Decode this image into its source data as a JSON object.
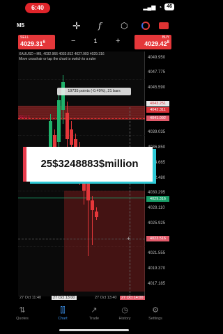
{
  "status": {
    "time": "6:40",
    "signal": "▂▄▆",
    "wifi": "◔",
    "battery": "46"
  },
  "toolbar": {
    "timeframe": "M5",
    "crosshair_icon": "crosshair-icon",
    "function_icon": "function-icon",
    "objects_icon": "objects-icon"
  },
  "trade": {
    "sell_label": "SELL",
    "sell_price_main": "4029.31",
    "sell_price_sup": "6",
    "buy_label": "BUY",
    "buy_price_main": "4029.42",
    "buy_price_sup": "8",
    "minus": "−",
    "volume": "1",
    "plus": "+"
  },
  "chart": {
    "symbol_info": "XAUUSD • M5, 4032.966 4033.812 4027.903 4029.316",
    "hint": "Move crosshair or tap the chart to switch to a ruler",
    "ruler_tooltip": "19735 points (-0.49%), 21 bars",
    "sell_line_label": "SELL 1",
    "crosshair_plus": "+"
  },
  "price_axis": {
    "ticks": [
      "4049.950",
      "4047.775",
      "4045.590",
      "4039.035",
      "4036.850",
      "4034.665",
      "4032.480",
      "4030.295",
      "4028.110",
      "4025.925",
      "4023.740",
      "4021.555",
      "4019.370",
      "4017.185"
    ],
    "tag_upper": "4043.251",
    "tag_upper2": "4042.311",
    "tag_sell": "4041.092",
    "tag_current": "4029.316",
    "tag_cursor": "4023.516"
  },
  "time_axis": {
    "t1": "27 Oct 11:40",
    "t2": "27 Oct 13:00",
    "t3": "27 Oct 13:40",
    "t4": "27 Oct 14:00"
  },
  "overlay": {
    "text": "25$3248883$million"
  },
  "nav": {
    "items": [
      {
        "label": "Quotes",
        "icon": "quotes-icon"
      },
      {
        "label": "Chart",
        "icon": "chart-icon"
      },
      {
        "label": "Trade",
        "icon": "trade-icon"
      },
      {
        "label": "History",
        "icon": "history-icon"
      },
      {
        "label": "Settings",
        "icon": "settings-icon"
      }
    ],
    "active": "Chart"
  },
  "colors": {
    "bear": "#e5373a",
    "bull": "#1fb26b",
    "accent": "#3a8ee6"
  }
}
